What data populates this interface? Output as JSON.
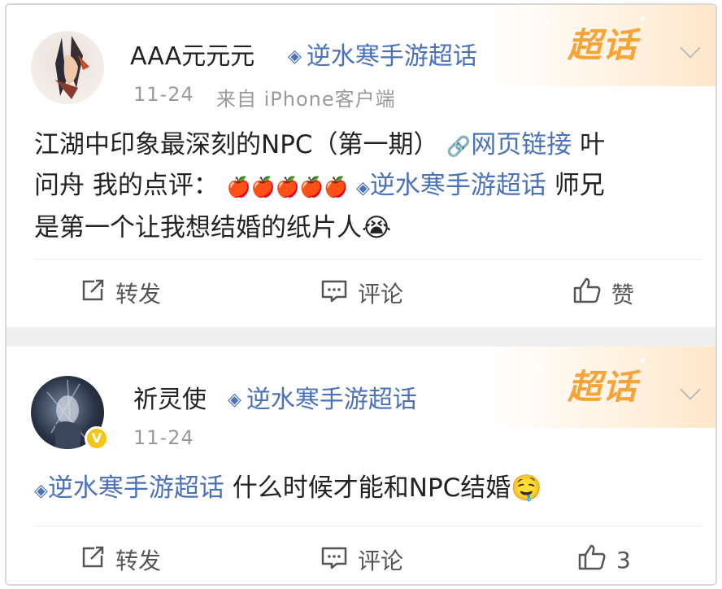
{
  "posts": [
    {
      "username": "AAA元元元",
      "topic_header": "逆水寒手游超话",
      "meta_date": "11-24",
      "meta_source": "来自 iPhone客户端",
      "content_line1_a": "江湖中印象最深刻的NPC（第一期）",
      "content_link": "网页链接",
      "content_line1_b": "叶",
      "content_line2_a": "问舟 我的点评：",
      "content_line2_emoji": "🍎🍎🍎🍎🍎",
      "content_topic": "逆水寒手游超话",
      "content_line2_b": "师兄",
      "content_line3": "是第一个让我想结婚的纸片人😭",
      "actions": {
        "repost": "转发",
        "comment": "评论",
        "like": "赞"
      }
    },
    {
      "username": "祈灵使",
      "topic_header": "逆水寒手游超话",
      "meta_date": "11-24",
      "verified": "V",
      "content_topic": "逆水寒手游超话",
      "content_text": "什么时候才能和NPC结婚🤤",
      "actions": {
        "repost": "转发",
        "comment": "评论",
        "like": "3"
      }
    }
  ],
  "banner": {
    "label": "超话"
  },
  "colors": {
    "link": "#4b72b8",
    "banner": "#f7a337",
    "meta": "#9a9a9a"
  },
  "icons": [
    "repost-icon",
    "comment-icon",
    "like-icon",
    "chevron-down-icon",
    "topic-diamond-icon",
    "link-icon"
  ]
}
